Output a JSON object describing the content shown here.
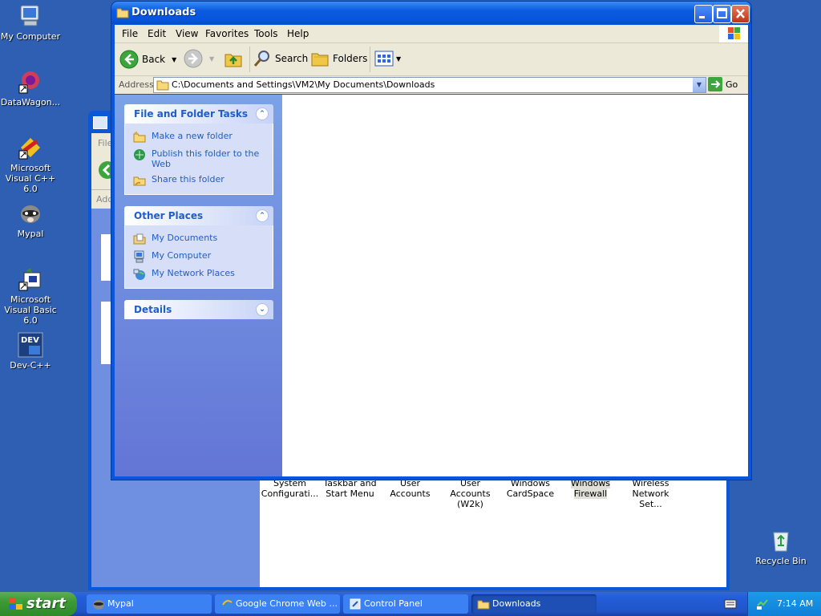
{
  "desktop": {
    "icons": [
      {
        "label": "My Computer",
        "icon": "my-computer-icon"
      },
      {
        "label": "DataWagon...",
        "icon": "datawagon-icon"
      },
      {
        "label": "Microsoft Visual C++ 6.0",
        "icon": "visual-cpp-icon"
      },
      {
        "label": "Mypal",
        "icon": "mypal-icon"
      },
      {
        "label": "Microsoft Visual Basic 6.0",
        "icon": "visual-basic-icon"
      },
      {
        "label": "Dev-C++",
        "icon": "dev-cpp-icon"
      },
      {
        "label": "Recycle Bin",
        "icon": "recycle-bin-icon"
      }
    ]
  },
  "background_window": {
    "partial_menu": "File",
    "partial_address": "Add",
    "items": [
      {
        "line1": "System",
        "line2": "Configurati..."
      },
      {
        "line1": "Taskbar and",
        "line2": "Start Menu"
      },
      {
        "line1": "User Accounts",
        "line2": ""
      },
      {
        "line1": "User Accounts",
        "line2": "(W2k)"
      },
      {
        "line1": "Windows",
        "line2": "CardSpace"
      },
      {
        "line1": "Windows",
        "line2": "Firewall"
      },
      {
        "line1": "Wireless",
        "line2": "Network Set..."
      }
    ]
  },
  "window": {
    "title": "Downloads",
    "menu": [
      "File",
      "Edit",
      "View",
      "Favorites",
      "Tools",
      "Help"
    ],
    "toolbar": {
      "back": "Back",
      "search": "Search",
      "folders": "Folders"
    },
    "address": {
      "label": "Address",
      "value": "C:\\Documents and Settings\\VM2\\My Documents\\Downloads",
      "go": "Go"
    },
    "task_pane": {
      "file_tasks": {
        "title": "File and Folder Tasks",
        "items": [
          "Make a new folder",
          "Publish this folder to the Web",
          "Share this folder"
        ]
      },
      "other_places": {
        "title": "Other Places",
        "items": [
          "My Documents",
          "My Computer",
          "My Network Places"
        ]
      },
      "details": {
        "title": "Details"
      }
    }
  },
  "taskbar": {
    "start": "start",
    "tasks": [
      {
        "label": "Mypal"
      },
      {
        "label": "Google Chrome Web ..."
      },
      {
        "label": "Control Panel"
      },
      {
        "label": "Downloads"
      }
    ],
    "clock": "7:14 AM"
  }
}
